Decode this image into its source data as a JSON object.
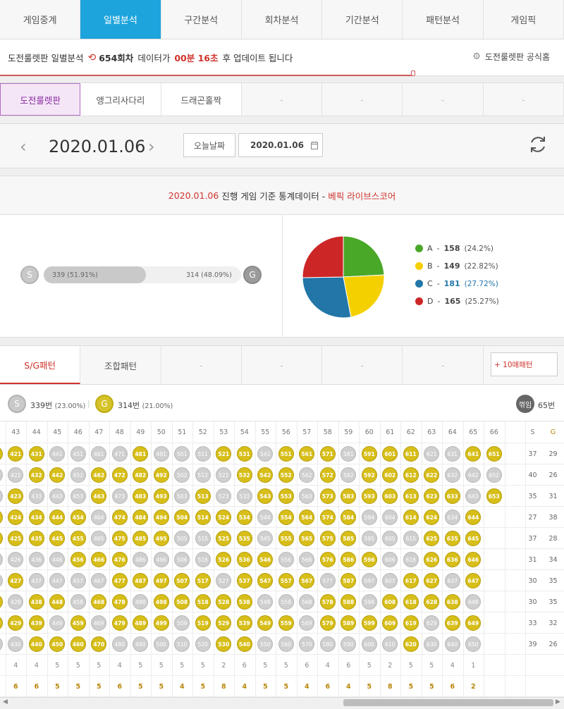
{
  "top_tabs": [
    "게임중계",
    "일별분석",
    "구간분석",
    "회차분석",
    "기간분석",
    "패턴분석",
    "게임픽"
  ],
  "active_top_tab": 1,
  "info": {
    "prefix": "도전룰렛판 일별분석",
    "round": "654회차",
    "mid": "데이터가",
    "time": "00분 16초",
    "suffix": "후 업데이트 됩니다",
    "official": "도전룰렛판 공식홈"
  },
  "game_tabs": [
    "도전룰렛판",
    "앵그리사다리",
    "드래곤홀짝",
    "-",
    "-",
    "-",
    "-"
  ],
  "date": {
    "display": "2020.01.06",
    "today_button": "오늘날짜",
    "input_value": "2020.01.06"
  },
  "stats": {
    "date": "2020.01.06",
    "text": "진행 게임 기준 통계데이터 -",
    "source": "베픽 라이브스코어",
    "s_label": "S",
    "g_label": "G",
    "s_text": "339 (51.91%)",
    "g_text": "314 (48.09%)",
    "s_fraction": 0.5191
  },
  "chart_data": {
    "type": "pie",
    "categories": [
      "A",
      "B",
      "C",
      "D"
    ],
    "values": [
      158,
      149,
      181,
      165
    ],
    "percents": [
      "(24.2%)",
      "(22.82%)",
      "(27.72%)",
      "(25.27%)"
    ],
    "colors": [
      "#4aa829",
      "#f5d000",
      "#2276a8",
      "#cc2626"
    ]
  },
  "pattern_tabs": [
    "S/G패턴",
    "조합패턴",
    "-",
    "-",
    "-",
    "-"
  ],
  "pattern_button": "+ 10매패턴",
  "summary": {
    "s_icon": "S",
    "s_count": "339번",
    "s_pct": "(23.00%)",
    "g_icon": "G",
    "g_count": "314번",
    "g_pct": "(21.00%)",
    "bend_icon": "꺾임",
    "bend_count": "65번"
  },
  "grid": {
    "columns": [
      "42",
      "43",
      "44",
      "45",
      "46",
      "47",
      "48",
      "49",
      "50",
      "51",
      "52",
      "53",
      "54",
      "55",
      "56",
      "57",
      "58",
      "59",
      "60",
      "61",
      "62",
      "63",
      "64",
      "65",
      "66"
    ],
    "s_header": "S",
    "g_header": "G",
    "pattern_rows": [
      "GGGSSSSGSSSGGSGGGSGGGSSGG",
      "SSGGSGGGGSSSGGGSGSGGGGSSS",
      "SGSSSGSGGSGSSGGSGGGGGGGSG",
      "GGGGGSGGGGGGGSGGGGSSGGSG",
      "GGGGGSGGGSSGGSGGGGSSSGGG",
      "SSSSGGGSSSSGGGSSGGGSSGGG",
      "SGSSSSGGGGGSGGGGSGSSGGSG",
      "GSGGSGGSGGGGGSSSGGSGGGGS",
      "GGGSGSGGGSGGGGGSGGGGGSGG",
      "SSGGGGSSSSSGGSSSSSSSGSSS"
    ],
    "s_counts": [
      "37",
      "40",
      "35",
      "27",
      "37",
      "31",
      "30",
      "30",
      "33",
      "39"
    ],
    "g_counts": [
      "29",
      "26",
      "31",
      "38",
      "28",
      "34",
      "35",
      "35",
      "32",
      "26"
    ],
    "bottom_row_1": [
      "5",
      "4",
      "4",
      "5",
      "5",
      "5",
      "4",
      "5",
      "5",
      "5",
      "5",
      "2",
      "6",
      "5",
      "5",
      "6",
      "4",
      "6",
      "5",
      "2",
      "5",
      "5",
      "4",
      "1"
    ],
    "bottom_row_2": [
      "5",
      "6",
      "6",
      "5",
      "5",
      "5",
      "6",
      "5",
      "5",
      "4",
      "5",
      "8",
      "4",
      "5",
      "5",
      "4",
      "6",
      "4",
      "5",
      "8",
      "5",
      "5",
      "6",
      "2"
    ]
  }
}
